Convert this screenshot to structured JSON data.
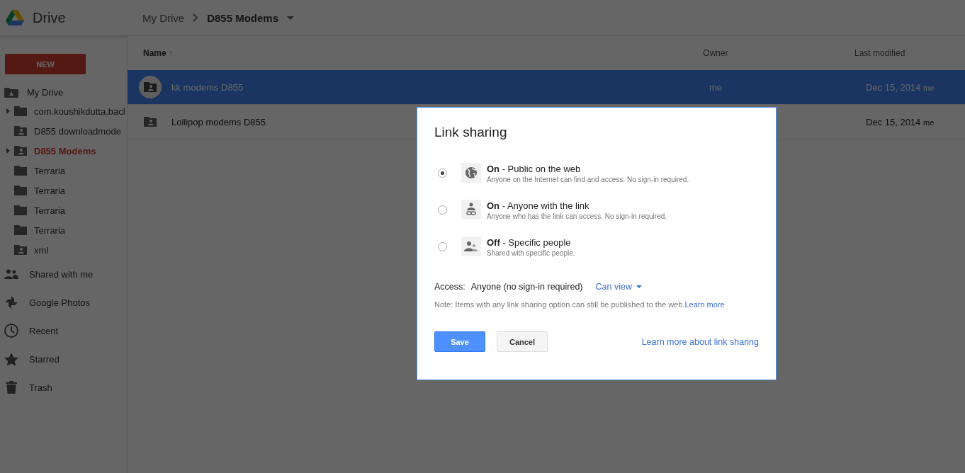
{
  "app": {
    "name": "Drive"
  },
  "breadcrumb": {
    "parent": "My Drive",
    "current": "D855 Modems"
  },
  "new_button": "NEW",
  "tree": {
    "label": "My Drive",
    "children": [
      {
        "label": "com.koushikdutta.bacl",
        "kind": "folder",
        "collapsed": true,
        "selected": false
      },
      {
        "label": "D855 downloadmode",
        "kind": "shared-folder",
        "collapsed": false,
        "selected": false
      },
      {
        "label": "D855 Modems",
        "kind": "shared-folder",
        "collapsed": true,
        "selected": true
      },
      {
        "label": "Terraria",
        "kind": "folder",
        "collapsed": false,
        "selected": false
      },
      {
        "label": "Terraria",
        "kind": "folder",
        "collapsed": false,
        "selected": false
      },
      {
        "label": "Terraria",
        "kind": "folder",
        "collapsed": false,
        "selected": false
      },
      {
        "label": "Terraria",
        "kind": "folder",
        "collapsed": false,
        "selected": false
      },
      {
        "label": "xml",
        "kind": "shared-folder",
        "collapsed": false,
        "selected": false
      }
    ]
  },
  "nav": [
    {
      "label": "Shared with me",
      "kind": "shared"
    },
    {
      "label": "Google Photos",
      "kind": "photos"
    },
    {
      "label": "Recent",
      "kind": "recent"
    },
    {
      "label": "Starred",
      "kind": "starred"
    },
    {
      "label": "Trash",
      "kind": "trash"
    }
  ],
  "table": {
    "columns": [
      "Name",
      "Owner",
      "Last modified"
    ],
    "sort_arrow": "↑",
    "rows": [
      {
        "name": "kk modems D855",
        "owner": "me",
        "modified": "Dec 15, 2014",
        "modified_by": "me",
        "selected": true
      },
      {
        "name": "Lollipop modems D855",
        "owner": "",
        "modified": "Dec 15, 2014",
        "modified_by": "me",
        "selected": false
      }
    ]
  },
  "dialog": {
    "title": "Link sharing",
    "options": [
      {
        "label": "**On** - Public on the web",
        "description": "Anyone on the Internet can find and access. No sign-in required.",
        "kind": "globe",
        "selected": true
      },
      {
        "label": "**On** - Anyone with the link",
        "description": "Anyone who has the link can access. No sign-in required.",
        "kind": "link",
        "selected": false
      },
      {
        "label": "**Off** - Specific people",
        "description": "Shared with specific people.",
        "kind": "people",
        "selected": false
      }
    ],
    "access_label": "Access:",
    "access_value": "Anyone (no sign-in required)",
    "permission": "Can view",
    "note": "Note: Items with any link sharing option can still be published to the web.",
    "note_link": "Learn more",
    "save": "Save",
    "cancel": "Cancel",
    "help_link": "Learn more about link sharing"
  }
}
